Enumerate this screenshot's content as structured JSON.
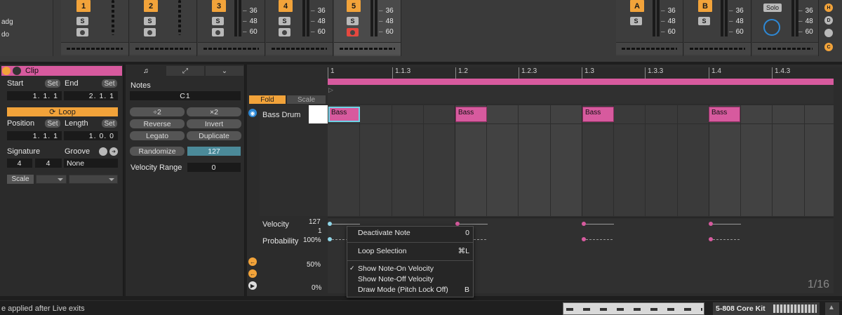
{
  "browser": {
    "items": [
      "adg",
      "do"
    ]
  },
  "tracks": [
    {
      "name": "1",
      "solo": "S"
    },
    {
      "name": "2",
      "solo": "S"
    },
    {
      "name": "3",
      "solo": "S"
    },
    {
      "name": "4",
      "solo": "S"
    },
    {
      "name": "5",
      "solo": "S"
    },
    {
      "name": "A",
      "solo": "S"
    },
    {
      "name": "B",
      "solo": "S"
    }
  ],
  "db_scale": [
    "36",
    "48",
    "60"
  ],
  "master": {
    "solo_label": "Solo"
  },
  "right_buttons": [
    "H",
    "D",
    "",
    "C"
  ],
  "clip": {
    "title": "Clip",
    "start_label": "Start",
    "end_label": "End",
    "set_label": "Set",
    "start_value": "1.  1.  1",
    "end_value": "2.  1.  1",
    "loop_label": "Loop",
    "position_label": "Position",
    "length_label": "Length",
    "position_value": "1.  1.  1",
    "length_value": "1.  0.  0",
    "signature_label": "Signature",
    "groove_label": "Groove",
    "sig_num": "4",
    "sig_den": "4",
    "groove_value": "None",
    "scale_label": "Scale"
  },
  "notes_panel": {
    "title": "Notes",
    "pitch": "C1",
    "btn_div2": "÷2",
    "btn_x2": "×2",
    "btn_reverse": "Reverse",
    "btn_invert": "Invert",
    "btn_legato": "Legato",
    "btn_duplicate": "Duplicate",
    "btn_randomize": "Randomize",
    "velocity_value": "127",
    "velocity_range_label": "Velocity Range",
    "velocity_range_value": "0"
  },
  "editor": {
    "fold": "Fold",
    "scale": "Scale",
    "ruler": [
      "1",
      "1.1.3",
      "1.2",
      "1.2.3",
      "1.3",
      "1.3.3",
      "1.4",
      "1.4.3"
    ],
    "lane_name": "Bass Drum",
    "note_label": "Bass",
    "page_indicator": "1/16"
  },
  "envelope": {
    "velocity_label": "Velocity",
    "probability_label": "Probability",
    "vel_max": "127",
    "vel_min": "1",
    "prob_100": "100%",
    "prob_50": "50%",
    "prob_0": "0%"
  },
  "context_menu": {
    "items": [
      {
        "label": "Deactivate Note",
        "key": "0"
      },
      {
        "label": "Loop Selection",
        "key": "⌘L"
      },
      {
        "label": "Show Note-On Velocity",
        "key": "",
        "checked": "✓"
      },
      {
        "label": "Show Note-Off Velocity",
        "key": ""
      },
      {
        "label": "Draw Mode (Pitch Lock Off)",
        "key": "B"
      }
    ]
  },
  "status": {
    "message": "e applied after Live exits",
    "device_name": "5-808 Core Kit"
  }
}
